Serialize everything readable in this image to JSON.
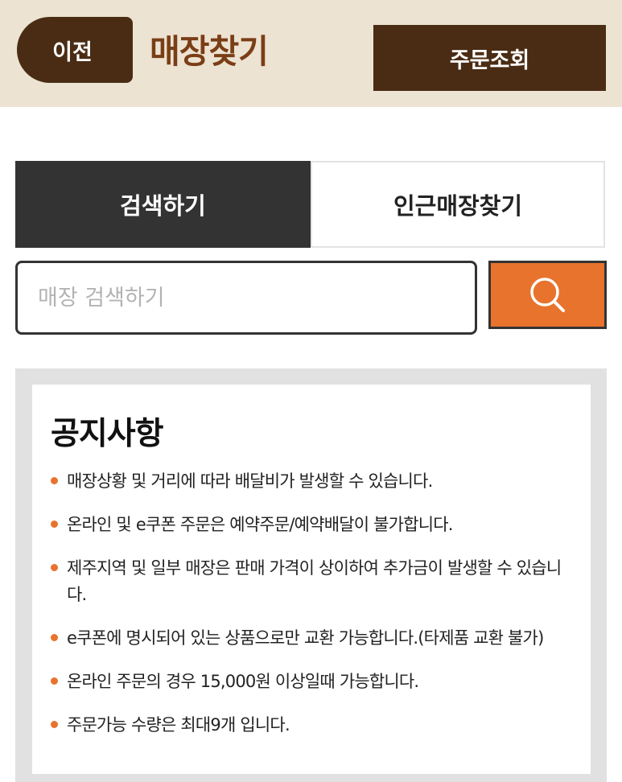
{
  "header": {
    "back_label": "이전",
    "title": "매장찾기",
    "order_lookup_label": "주문조회"
  },
  "tabs": [
    {
      "label": "검색하기",
      "active": true
    },
    {
      "label": "인근매장찾기",
      "active": false
    }
  ],
  "search": {
    "placeholder": "매장 검색하기",
    "value": "",
    "button_icon": "search-icon"
  },
  "notice": {
    "title": "공지사항",
    "items": [
      "매장상황 및 거리에 따라 배달비가 발생할 수 있습니다.",
      "온라인 및 e쿠폰 주문은 예약주문/예약배달이 불가합니다.",
      "제주지역 및 일부 매장은 판매 가격이 상이하여 추가금이 발생할 수 있습니다.",
      "e쿠폰에 명시되어 있는 상품으로만 교환 가능합니다.(타제품 교환 불가)",
      "온라인 주문의 경우 15,000원 이상일때 가능합니다.",
      "주문가능 수량은 최대9개 입니다."
    ]
  },
  "colors": {
    "header_bg": "#ece3d2",
    "brand_brown": "#4a2c14",
    "title_brown": "#7a3e16",
    "accent_orange": "#e8732d",
    "active_tab": "#333333"
  }
}
